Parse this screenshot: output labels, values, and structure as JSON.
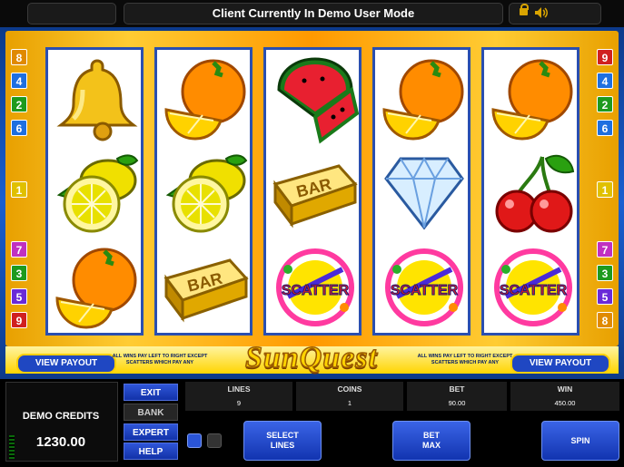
{
  "header": {
    "title": "Client Currently In Demo User Mode"
  },
  "game": {
    "logo": "SunQuest"
  },
  "reels": [
    [
      "bell-icon",
      "lemon-icon",
      "orange-icon"
    ],
    [
      "orange-icon",
      "lemon-icon",
      "bar-icon"
    ],
    [
      "watermelon-icon",
      "bar-icon",
      "scatter-icon"
    ],
    [
      "orange-icon",
      "diamond-icon",
      "scatter-icon"
    ],
    [
      "orange-icon",
      "cherry-icon",
      "scatter-icon"
    ]
  ],
  "symbols": {
    "bar_text": "BAR",
    "scatter_text": "SCATTER"
  },
  "paylines": {
    "left": [
      "8",
      "4",
      "2",
      "6",
      "1",
      "7",
      "3",
      "5",
      "9"
    ],
    "right": [
      "9",
      "4",
      "2",
      "6",
      "1",
      "7",
      "3",
      "5",
      "8"
    ]
  },
  "payout": {
    "left_label": "VIEW PAYOUT",
    "right_label": "VIEW PAYOUT",
    "note": "ALL WINS PAY LEFT TO RIGHT EXCEPT SCATTERS WHICH PAY ANY"
  },
  "credits": {
    "label": "DEMO CREDITS",
    "value": "1230.00"
  },
  "side_buttons": {
    "exit": "EXIT",
    "bank": "BANK",
    "expert": "EXPERT",
    "help": "HELP"
  },
  "info": {
    "lines_label": "LINES",
    "lines_value": "9",
    "coins_label": "COINS",
    "coins_value": "1",
    "bet_label": "BET",
    "bet_value": "90.00",
    "win_label": "WIN",
    "win_value": "450.00"
  },
  "controls": {
    "select_lines": "SELECT\nLINES",
    "bet_max": "BET\nMAX",
    "spin": "SPIN"
  },
  "colors": {
    "accent_blue": "#1f47c2",
    "frame_gold": "#ffcc33",
    "payout_gold": "#ffd000"
  }
}
